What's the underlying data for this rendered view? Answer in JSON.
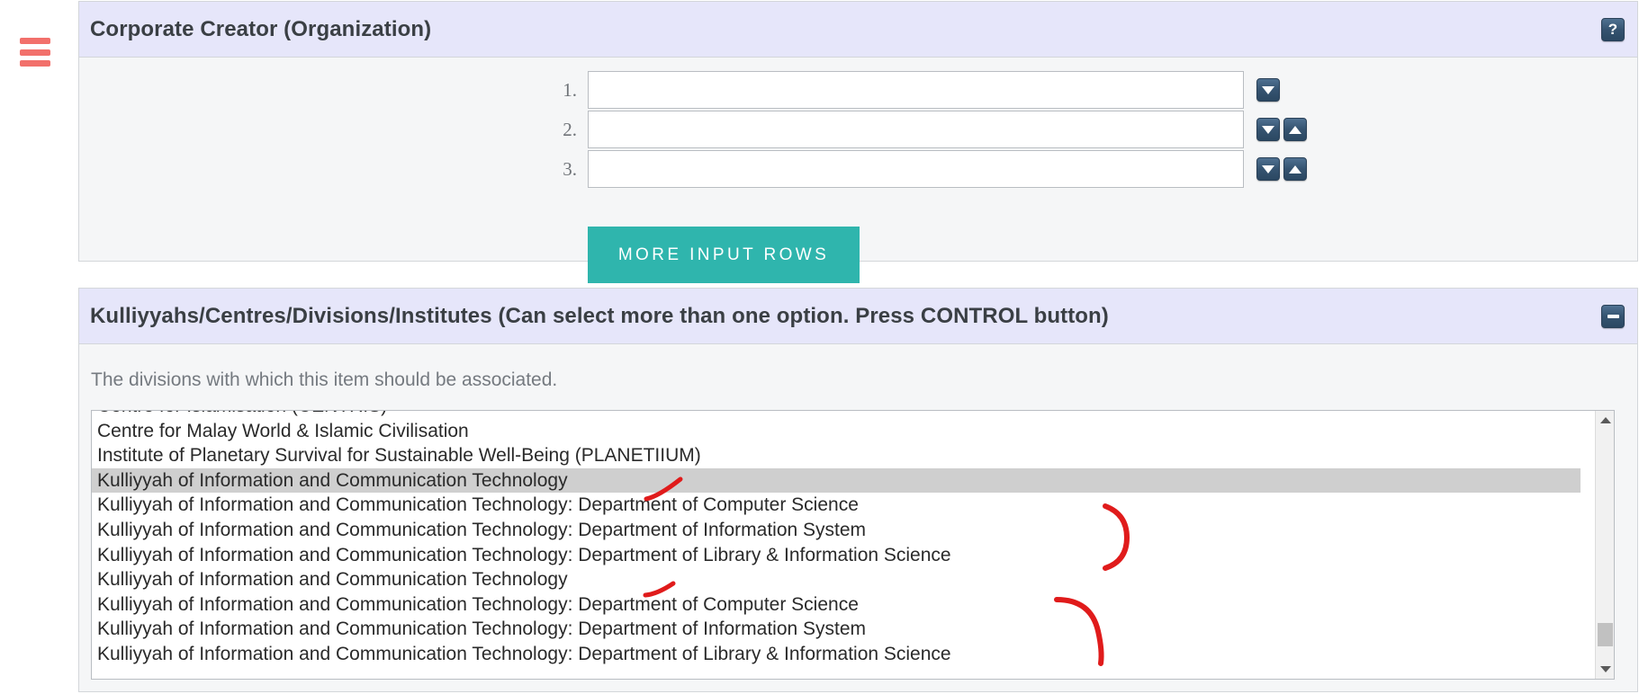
{
  "nav": {
    "menu_icon": "hamburger-menu-icon",
    "menu_color": "#f2706b"
  },
  "panels": [
    {
      "id": "corporate-creator",
      "title": "Corporate Creator (Organization)",
      "header_bg": "#e6e6fa",
      "header_button": {
        "name": "help-button",
        "glyph": "?"
      },
      "input_rows": [
        {
          "number": "1.",
          "value": "",
          "placeholder": "",
          "arrows": [
            "down"
          ]
        },
        {
          "number": "2.",
          "value": "",
          "placeholder": "",
          "arrows": [
            "down",
            "up"
          ]
        },
        {
          "number": "3.",
          "value": "",
          "placeholder": "",
          "arrows": [
            "down",
            "up"
          ]
        }
      ],
      "more_rows_label": "MORE INPUT ROWS",
      "more_rows_color": "#2fb5ad"
    },
    {
      "id": "divisions",
      "title": "Kulliyyahs/Centres/Divisions/Institutes (Can select more than one option. Press CONTROL button)",
      "header_bg": "#e6e6fa",
      "header_button": {
        "name": "collapse-button",
        "glyph": "−"
      },
      "description": "The divisions with which this item should be associated.",
      "options": [
        {
          "label": "Centre for Islamisation (CENTRIS)",
          "selected": false
        },
        {
          "label": "Centre for Malay World & Islamic Civilisation",
          "selected": false
        },
        {
          "label": "Institute of Planetary Survival for Sustainable Well-Being (PLANETIIUM)",
          "selected": false
        },
        {
          "label": "Kulliyyah of Information and Communication Technology",
          "selected": true
        },
        {
          "label": "Kulliyyah of Information and Communication Technology: Department of Computer Science",
          "selected": false
        },
        {
          "label": "Kulliyyah of Information and Communication Technology: Department of Information System",
          "selected": false
        },
        {
          "label": "Kulliyyah of Information and Communication Technology: Department of Library & Information Science",
          "selected": false
        },
        {
          "label": "Kulliyyah of Information and Communication Technology",
          "selected": false
        },
        {
          "label": "Kulliyyah of Information and Communication Technology: Department of Computer Science",
          "selected": false
        },
        {
          "label": "Kulliyyah of Information and Communication Technology: Department of Information System",
          "selected": false
        },
        {
          "label": "Kulliyyah of Information and Communication Technology: Department of Library & Information Science",
          "selected": false
        }
      ],
      "scrollbar": {
        "position_percent": 86
      }
    }
  ],
  "annotations": {
    "color": "#e01b1b",
    "marks": [
      {
        "name": "tick-mark-upper",
        "kind": "tick"
      },
      {
        "name": "brace-upper",
        "kind": "brace"
      },
      {
        "name": "tick-mark-lower",
        "kind": "tick"
      },
      {
        "name": "brace-lower",
        "kind": "brace"
      }
    ]
  }
}
